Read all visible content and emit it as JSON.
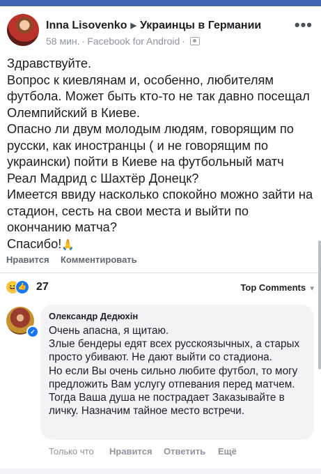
{
  "post": {
    "author": "Inna Lisovenko",
    "group": "Украинцы в Германии",
    "time": "58 мин.",
    "source": "Facebook for Android",
    "body_lines": [
      "Здравствуйте.",
      "Вопрос к киевлянам и, особенно, любителям футбола. Может быть кто-то не так давно посещал Олемпийский в Киеве.",
      "Опасно ли двум молодым людям, говорящим по русски, как иностранцы ( и не говорящим по украински) пойти в Киеве на футбольный матч Реал Мадрид с Шахтёр Донецк?",
      "Имеется ввиду насколько спокойно можно зайти на стадион, сесть на свои места и выйти по окончанию матча?",
      "Спасибо!"
    ],
    "emoji_end": "🙏"
  },
  "actions": {
    "like": "Нравится",
    "comment": "Комментировать"
  },
  "reactions": {
    "count": "27",
    "icons": [
      "haha-icon",
      "like-icon"
    ],
    "sort_label": "Top Comments"
  },
  "comment": {
    "author": "Олександр Дедюхін",
    "lines": [
      "Очень апасна, я щитаю.",
      "Злые бендеры едят всех русскоязычных, а старых просто убивают. Не дают выйти со стадиона.",
      "Но если Вы очень сильно любите футбол, то могу предложить Вам услугу отпевания перед матчем. Тогда Ваша душа не пострадает Заказывайте в личку. Назначим тайное место встречи."
    ],
    "time": "Только что",
    "like": "Нравится",
    "reply": "Ответить",
    "more": "Ещё"
  },
  "colors": {
    "brand": "#4267b2",
    "bubble": "#f2f3f5",
    "like_blue": "#1877f2",
    "meta_gray": "#90949c"
  }
}
